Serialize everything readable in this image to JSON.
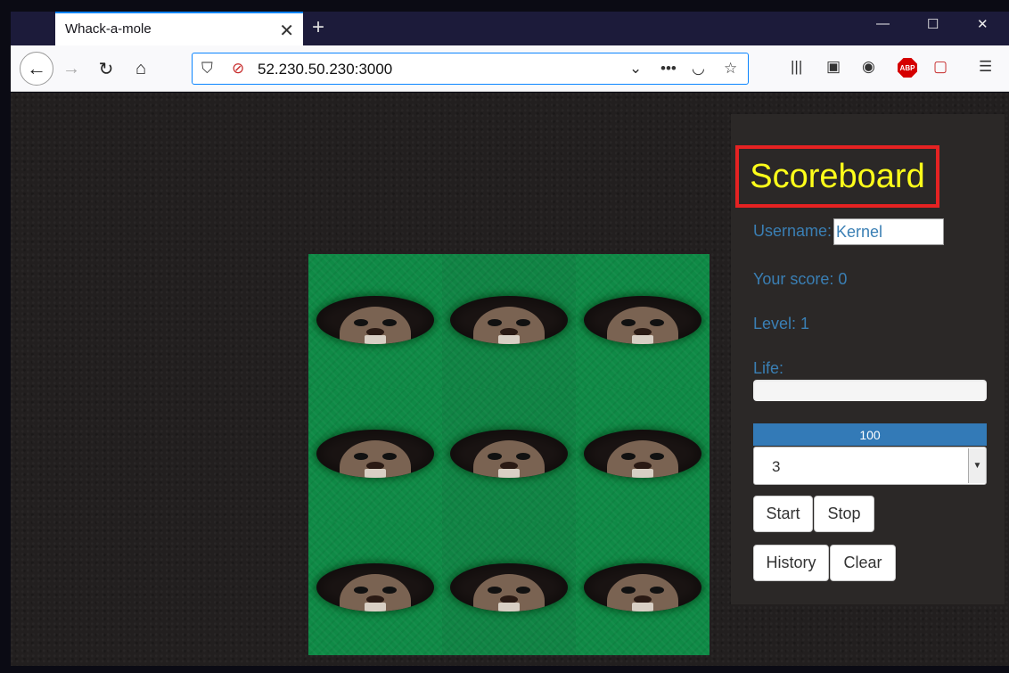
{
  "browser": {
    "tab_title": "Whack-a-mole",
    "url": "52.230.50.230:3000",
    "icons": [
      "back-arrow-icon",
      "forward-arrow-icon",
      "reload-icon",
      "home-icon",
      "shield-icon",
      "no-lock-icon",
      "chevron-down-icon",
      "more-icon",
      "pocket-icon",
      "star-icon",
      "library-icon",
      "reader-icon",
      "account-icon",
      "abp-icon",
      "extension-icon",
      "menu-icon"
    ],
    "abp_label": "ABP"
  },
  "scoreboard": {
    "title": "Scoreboard",
    "username_label": "Username:",
    "username_value": "Kernel",
    "score_label": "Your score: 0",
    "level_label": "Level: 1",
    "life_label": "Life:",
    "progress_value": "100",
    "progress_fraction": 1.0,
    "level_select_value": "3",
    "buttons": {
      "start": "Start",
      "stop": "Stop",
      "history": "History",
      "clear": "Clear"
    }
  },
  "board": {
    "rows": 3,
    "cols": 3
  },
  "colors": {
    "title": "#ffff1a",
    "title_border": "#e52222",
    "label": "#3a7fb4",
    "progress": "#337ab7",
    "grass": "#0f8a46"
  }
}
